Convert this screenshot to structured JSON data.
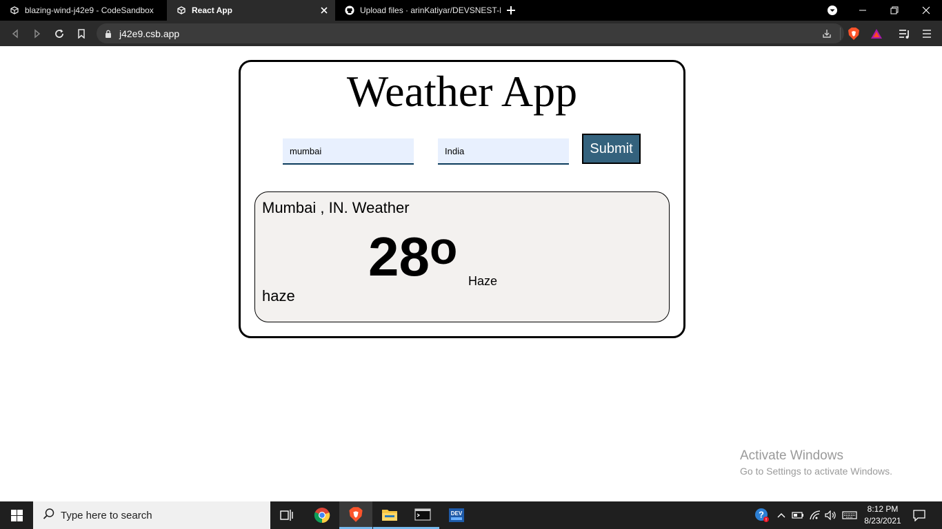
{
  "browser": {
    "tabs": [
      {
        "title": "blazing-wind-j42e9 - CodeSandbox"
      },
      {
        "title": "React App"
      },
      {
        "title": "Upload files · arinKatiyar/DEVSNEST-FI"
      }
    ],
    "url": "j42e9.csb.app"
  },
  "app": {
    "title": "Weather App",
    "city_value": "mumbai",
    "country_value": "India",
    "submit_label": "Submit",
    "result": {
      "location": "Mumbai , IN. Weather",
      "temperature": "28",
      "degree_symbol": "o",
      "description_main": "Haze",
      "description_detail": "haze"
    }
  },
  "activation": {
    "line1": "Activate Windows",
    "line2": "Go to Settings to activate Windows."
  },
  "taskbar": {
    "search_placeholder": "Type here to search",
    "time": "8:12 PM",
    "date": "8/23/2021"
  },
  "colors": {
    "submit_bg": "#34627d",
    "input_bg": "#e8f0fe",
    "result_bg": "#f3f1ef",
    "taskbar_accent": "#76b9ed",
    "brave_orange": "#fb542b"
  }
}
